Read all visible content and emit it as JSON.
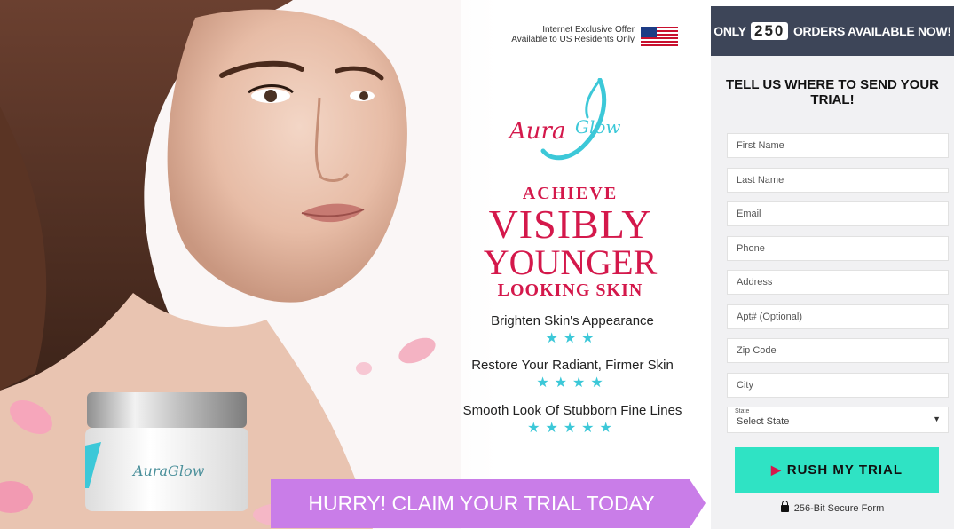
{
  "hero": {
    "offer_line_1": "Internet Exclusive Offer",
    "offer_line_2": "Available to US Residents Only",
    "brand_logo": "Aura Glow",
    "headline": {
      "line1": "ACHIEVE",
      "line2": "VISIBLY",
      "line3": "YOUNGER",
      "line4": "LOOKING SKIN"
    },
    "benefits": [
      {
        "text": "Brighten Skin's Appearance",
        "stars": "★★★"
      },
      {
        "text": "Restore Your Radiant, Firmer Skin",
        "stars": "★★★★"
      },
      {
        "text": "Smooth Look Of Stubborn Fine Lines",
        "stars": "★★★★★"
      }
    ],
    "jar_label": "AuraGlow",
    "cta_banner": "HURRY! CLAIM YOUR TRIAL TODAY"
  },
  "form": {
    "urgency_prefix": "ONLY",
    "urgency_count": "250",
    "urgency_suffix": "ORDERS AVAILABLE NOW!",
    "title": "TELL US WHERE TO SEND YOUR TRIAL!",
    "fields": {
      "first_name": "First Name",
      "last_name": "Last Name",
      "email": "Email",
      "phone": "Phone",
      "address": "Address",
      "apt": "Apt# (Optional)",
      "zip": "Zip Code",
      "city": "City"
    },
    "state_label": "State",
    "state_value": "Select State",
    "submit": "RUSH MY TRIAL",
    "secure_note": "256-Bit Secure Form"
  },
  "colors": {
    "brand_pink": "#d4184b",
    "brand_teal": "#3cc8d8",
    "cta_purple": "#c97de8",
    "button_mint": "#2fe3c4",
    "panel_header": "#3d4558"
  }
}
